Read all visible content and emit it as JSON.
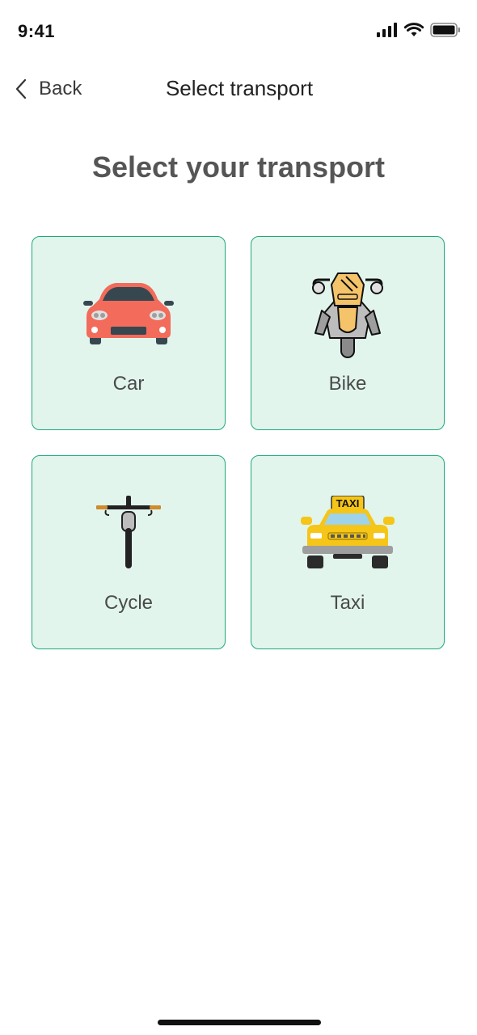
{
  "status_bar": {
    "time": "9:41",
    "icons": [
      "signal-icon",
      "wifi-icon",
      "battery-icon"
    ]
  },
  "nav": {
    "back_label": "Back",
    "title": "Select transport"
  },
  "heading": "Select your transport",
  "options": [
    {
      "label": "Car",
      "icon": "car-icon",
      "color": "#f26b5b"
    },
    {
      "label": "Bike",
      "icon": "motorbike-icon",
      "color": "#f5c46a"
    },
    {
      "label": "Cycle",
      "icon": "bicycle-icon",
      "color": "#222222"
    },
    {
      "label": "Taxi",
      "icon": "taxi-icon",
      "color": "#f5c518",
      "sign_text": "TAXI"
    }
  ],
  "colors": {
    "tile_background": "#e1f5ec",
    "tile_border": "#1fa97a",
    "heading_text": "#555555"
  }
}
